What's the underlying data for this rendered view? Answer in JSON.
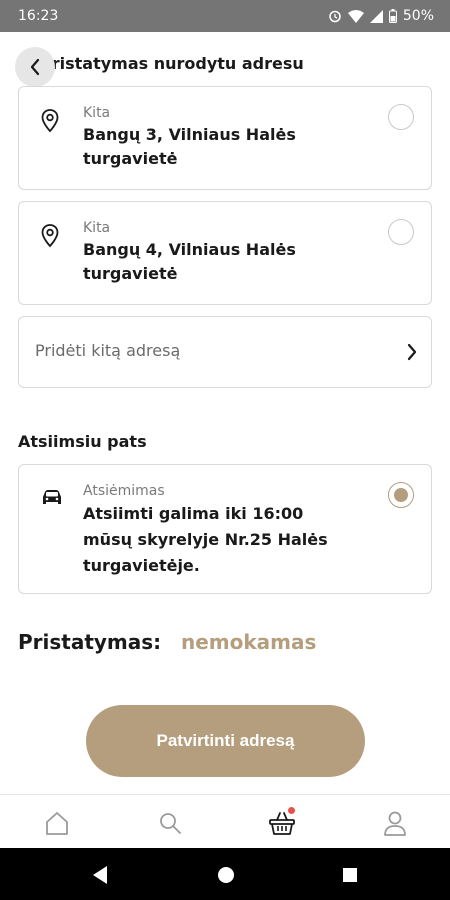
{
  "status_bar": {
    "time": "16:23",
    "battery": "50%"
  },
  "header": {
    "title": "Pristatymas nurodytu adresu"
  },
  "addresses": [
    {
      "type_label": "Kita",
      "line1": "Bangų 3, Vilniaus Halės",
      "line2": "turgavietė"
    },
    {
      "type_label": "Kita",
      "line1": "Bangų 4, Vilniaus Halės",
      "line2": "turgavietė"
    }
  ],
  "add_address": {
    "label": "Pridėti kitą adresą"
  },
  "pickup_section": {
    "title": "Atsiimsiu pats"
  },
  "pickup": {
    "type_label": "Atsiėmimas",
    "line1": "Atsiimti galima iki 16:00",
    "line2": "mūsų skyrelyje Nr.25 Halės",
    "line3": "turgavietėje."
  },
  "delivery": {
    "label": "Pristatymas:",
    "value": "nemokamas"
  },
  "confirm_button": {
    "label": "Patvirtinti adresą"
  },
  "tabs": [
    {
      "icon": "home-icon"
    },
    {
      "icon": "search-icon"
    },
    {
      "icon": "basket-icon",
      "badge": true
    },
    {
      "icon": "user-icon"
    }
  ],
  "colors": {
    "accent": "#b59e7d",
    "badge": "#e8504a"
  }
}
